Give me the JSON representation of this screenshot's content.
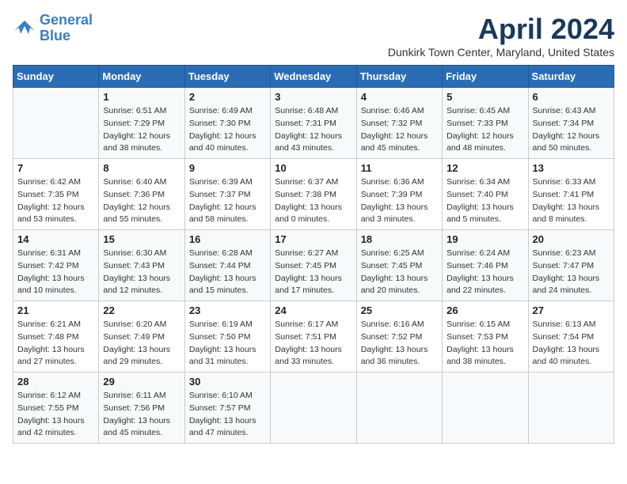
{
  "logo": {
    "line1": "General",
    "line2": "Blue"
  },
  "title": "April 2024",
  "subtitle": "Dunkirk Town Center, Maryland, United States",
  "weekdays": [
    "Sunday",
    "Monday",
    "Tuesday",
    "Wednesday",
    "Thursday",
    "Friday",
    "Saturday"
  ],
  "weeks": [
    [
      {
        "day": "",
        "sunrise": "",
        "sunset": "",
        "daylight": ""
      },
      {
        "day": "1",
        "sunrise": "Sunrise: 6:51 AM",
        "sunset": "Sunset: 7:29 PM",
        "daylight": "Daylight: 12 hours and 38 minutes."
      },
      {
        "day": "2",
        "sunrise": "Sunrise: 6:49 AM",
        "sunset": "Sunset: 7:30 PM",
        "daylight": "Daylight: 12 hours and 40 minutes."
      },
      {
        "day": "3",
        "sunrise": "Sunrise: 6:48 AM",
        "sunset": "Sunset: 7:31 PM",
        "daylight": "Daylight: 12 hours and 43 minutes."
      },
      {
        "day": "4",
        "sunrise": "Sunrise: 6:46 AM",
        "sunset": "Sunset: 7:32 PM",
        "daylight": "Daylight: 12 hours and 45 minutes."
      },
      {
        "day": "5",
        "sunrise": "Sunrise: 6:45 AM",
        "sunset": "Sunset: 7:33 PM",
        "daylight": "Daylight: 12 hours and 48 minutes."
      },
      {
        "day": "6",
        "sunrise": "Sunrise: 6:43 AM",
        "sunset": "Sunset: 7:34 PM",
        "daylight": "Daylight: 12 hours and 50 minutes."
      }
    ],
    [
      {
        "day": "7",
        "sunrise": "Sunrise: 6:42 AM",
        "sunset": "Sunset: 7:35 PM",
        "daylight": "Daylight: 12 hours and 53 minutes."
      },
      {
        "day": "8",
        "sunrise": "Sunrise: 6:40 AM",
        "sunset": "Sunset: 7:36 PM",
        "daylight": "Daylight: 12 hours and 55 minutes."
      },
      {
        "day": "9",
        "sunrise": "Sunrise: 6:39 AM",
        "sunset": "Sunset: 7:37 PM",
        "daylight": "Daylight: 12 hours and 58 minutes."
      },
      {
        "day": "10",
        "sunrise": "Sunrise: 6:37 AM",
        "sunset": "Sunset: 7:38 PM",
        "daylight": "Daylight: 13 hours and 0 minutes."
      },
      {
        "day": "11",
        "sunrise": "Sunrise: 6:36 AM",
        "sunset": "Sunset: 7:39 PM",
        "daylight": "Daylight: 13 hours and 3 minutes."
      },
      {
        "day": "12",
        "sunrise": "Sunrise: 6:34 AM",
        "sunset": "Sunset: 7:40 PM",
        "daylight": "Daylight: 13 hours and 5 minutes."
      },
      {
        "day": "13",
        "sunrise": "Sunrise: 6:33 AM",
        "sunset": "Sunset: 7:41 PM",
        "daylight": "Daylight: 13 hours and 8 minutes."
      }
    ],
    [
      {
        "day": "14",
        "sunrise": "Sunrise: 6:31 AM",
        "sunset": "Sunset: 7:42 PM",
        "daylight": "Daylight: 13 hours and 10 minutes."
      },
      {
        "day": "15",
        "sunrise": "Sunrise: 6:30 AM",
        "sunset": "Sunset: 7:43 PM",
        "daylight": "Daylight: 13 hours and 12 minutes."
      },
      {
        "day": "16",
        "sunrise": "Sunrise: 6:28 AM",
        "sunset": "Sunset: 7:44 PM",
        "daylight": "Daylight: 13 hours and 15 minutes."
      },
      {
        "day": "17",
        "sunrise": "Sunrise: 6:27 AM",
        "sunset": "Sunset: 7:45 PM",
        "daylight": "Daylight: 13 hours and 17 minutes."
      },
      {
        "day": "18",
        "sunrise": "Sunrise: 6:25 AM",
        "sunset": "Sunset: 7:45 PM",
        "daylight": "Daylight: 13 hours and 20 minutes."
      },
      {
        "day": "19",
        "sunrise": "Sunrise: 6:24 AM",
        "sunset": "Sunset: 7:46 PM",
        "daylight": "Daylight: 13 hours and 22 minutes."
      },
      {
        "day": "20",
        "sunrise": "Sunrise: 6:23 AM",
        "sunset": "Sunset: 7:47 PM",
        "daylight": "Daylight: 13 hours and 24 minutes."
      }
    ],
    [
      {
        "day": "21",
        "sunrise": "Sunrise: 6:21 AM",
        "sunset": "Sunset: 7:48 PM",
        "daylight": "Daylight: 13 hours and 27 minutes."
      },
      {
        "day": "22",
        "sunrise": "Sunrise: 6:20 AM",
        "sunset": "Sunset: 7:49 PM",
        "daylight": "Daylight: 13 hours and 29 minutes."
      },
      {
        "day": "23",
        "sunrise": "Sunrise: 6:19 AM",
        "sunset": "Sunset: 7:50 PM",
        "daylight": "Daylight: 13 hours and 31 minutes."
      },
      {
        "day": "24",
        "sunrise": "Sunrise: 6:17 AM",
        "sunset": "Sunset: 7:51 PM",
        "daylight": "Daylight: 13 hours and 33 minutes."
      },
      {
        "day": "25",
        "sunrise": "Sunrise: 6:16 AM",
        "sunset": "Sunset: 7:52 PM",
        "daylight": "Daylight: 13 hours and 36 minutes."
      },
      {
        "day": "26",
        "sunrise": "Sunrise: 6:15 AM",
        "sunset": "Sunset: 7:53 PM",
        "daylight": "Daylight: 13 hours and 38 minutes."
      },
      {
        "day": "27",
        "sunrise": "Sunrise: 6:13 AM",
        "sunset": "Sunset: 7:54 PM",
        "daylight": "Daylight: 13 hours and 40 minutes."
      }
    ],
    [
      {
        "day": "28",
        "sunrise": "Sunrise: 6:12 AM",
        "sunset": "Sunset: 7:55 PM",
        "daylight": "Daylight: 13 hours and 42 minutes."
      },
      {
        "day": "29",
        "sunrise": "Sunrise: 6:11 AM",
        "sunset": "Sunset: 7:56 PM",
        "daylight": "Daylight: 13 hours and 45 minutes."
      },
      {
        "day": "30",
        "sunrise": "Sunrise: 6:10 AM",
        "sunset": "Sunset: 7:57 PM",
        "daylight": "Daylight: 13 hours and 47 minutes."
      },
      {
        "day": "",
        "sunrise": "",
        "sunset": "",
        "daylight": ""
      },
      {
        "day": "",
        "sunrise": "",
        "sunset": "",
        "daylight": ""
      },
      {
        "day": "",
        "sunrise": "",
        "sunset": "",
        "daylight": ""
      },
      {
        "day": "",
        "sunrise": "",
        "sunset": "",
        "daylight": ""
      }
    ]
  ]
}
